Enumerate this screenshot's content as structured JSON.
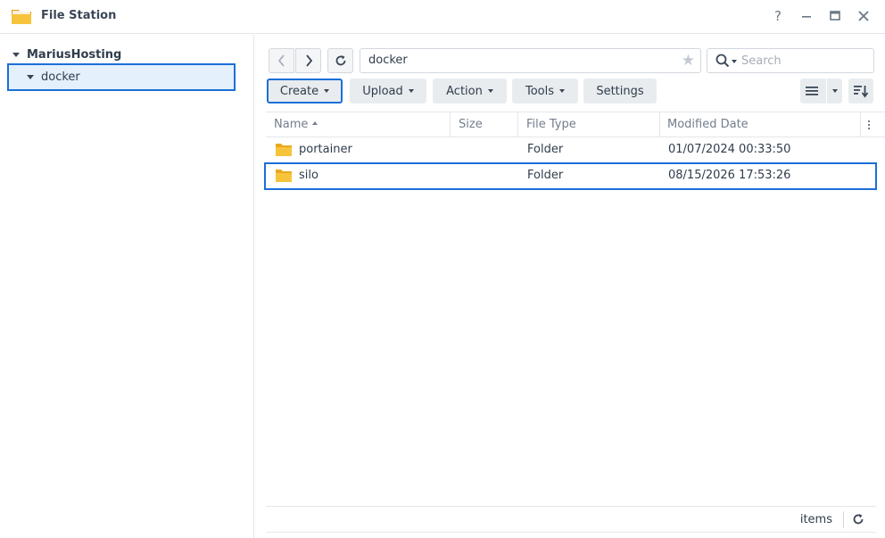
{
  "window": {
    "title": "File Station",
    "help_icon": "?",
    "minimize_icon": "—",
    "maximize_icon": "▭",
    "close_icon": "✕"
  },
  "sidebar": {
    "root_label": "MariusHosting",
    "items": [
      {
        "label": "docker",
        "selected": true
      }
    ]
  },
  "toolbar": {
    "path": "docker",
    "search_placeholder": "Search",
    "buttons": {
      "create": "Create",
      "upload": "Upload",
      "action": "Action",
      "tools": "Tools",
      "settings": "Settings"
    }
  },
  "file_list": {
    "columns": {
      "name": "Name",
      "size": "Size",
      "type": "File Type",
      "modified": "Modified Date"
    },
    "rows": [
      {
        "name": "portainer",
        "size": "",
        "type": "Folder",
        "modified": "01/07/2024 00:33:50"
      },
      {
        "name": "silo",
        "size": "",
        "type": "Folder",
        "modified": "08/15/2026 17:53:26"
      }
    ]
  },
  "footer": {
    "items_label": "items"
  },
  "colors": {
    "accent": "#1b6fd8",
    "folder": "#f7c33b",
    "selected_bg": "#e5f0fd"
  }
}
